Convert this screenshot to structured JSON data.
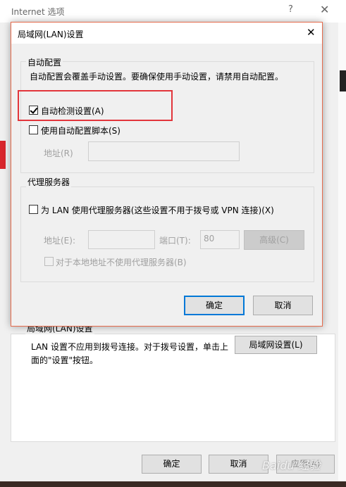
{
  "background_window": {
    "title": "Internet 选项",
    "help_icon": "?",
    "close_icon": "✕",
    "lan_group_label": "局域网(LAN)设置",
    "lan_text": "LAN 设置不应用到拨号连接。对于拨号设置，单击上面的\"设置\"按钮。",
    "lan_button": "局域网设置(L)",
    "ok": "确定",
    "cancel": "取消",
    "apply": "应用(A)"
  },
  "dialog": {
    "title": "局域网(LAN)设置",
    "close_icon": "✕",
    "auto_config": {
      "group_label": "自动配置",
      "description": "自动配置会覆盖手动设置。要确保使用手动设置，请禁用自动配置。",
      "auto_detect_label": "自动检测设置(A)",
      "auto_detect_checked": true,
      "script_label": "使用自动配置脚本(S)",
      "script_checked": false,
      "address_label": "地址(R)",
      "address_value": ""
    },
    "proxy": {
      "group_label": "代理服务器",
      "use_proxy_label": "为 LAN 使用代理服务器(这些设置不用于拨号或 VPN 连接)(X)",
      "use_proxy_checked": false,
      "address_label": "地址(E):",
      "address_value": "",
      "port_label": "端口(T):",
      "port_value": "80",
      "advanced_button": "高级(C)",
      "bypass_label": "对于本地地址不使用代理服务器(B)",
      "bypass_checked": false
    },
    "ok": "确定",
    "cancel": "取消"
  },
  "watermark": "Baidu 经验",
  "colors": {
    "highlight": "#e2353b",
    "dialog_border": "#e66b4c",
    "primary_focus": "#0078d7"
  }
}
